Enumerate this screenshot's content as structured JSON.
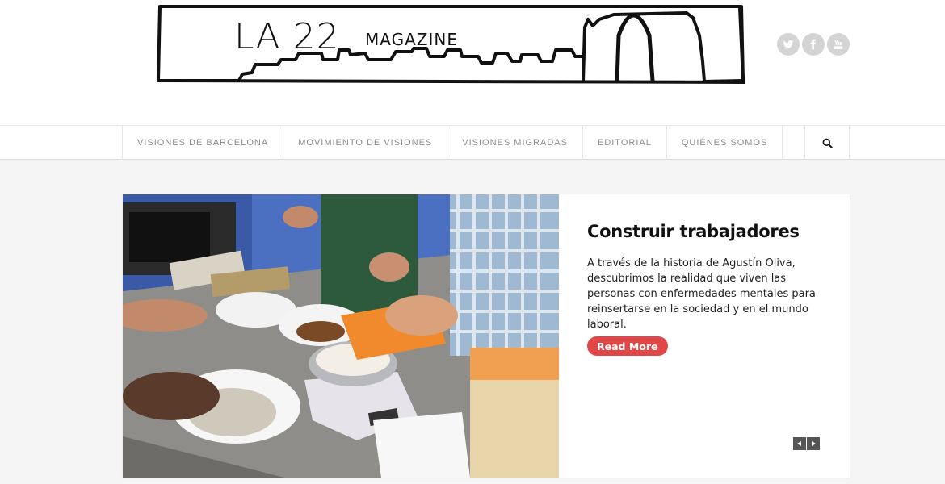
{
  "header": {
    "logo": {
      "text_main": "LA 22",
      "text_sub": "MAGAZINE"
    },
    "social": [
      {
        "name": "twitter",
        "icon": "twitter-icon"
      },
      {
        "name": "facebook",
        "icon": "facebook-icon"
      },
      {
        "name": "youtube",
        "icon": "youtube-icon"
      }
    ]
  },
  "nav": {
    "items": [
      {
        "label": "VISIONES DE BARCELONA"
      },
      {
        "label": "MOVIMIENTO DE VISIONES"
      },
      {
        "label": "VISIONES MIGRADAS"
      },
      {
        "label": "EDITORIAL"
      },
      {
        "label": "QUIÉNES SOMOS"
      }
    ],
    "search_icon": "search-icon"
  },
  "slider": {
    "title": "Construir trabajadores",
    "excerpt": "A través de la historia de Agustín Oliva, descubrimos la realidad que viven las personas con enfermedades mentales para reinsertarse en la sociedad y en el mundo laboral.",
    "read_more_label": "Read More",
    "image_subject": "cooking-class-photo",
    "prev_icon": "arrow-left-icon",
    "next_icon": "arrow-right-icon"
  },
  "colors": {
    "accent": "#e04747",
    "background": "#f5f5f5",
    "social_bg": "#d4d4d4",
    "nav_text": "#8a8a8a"
  }
}
